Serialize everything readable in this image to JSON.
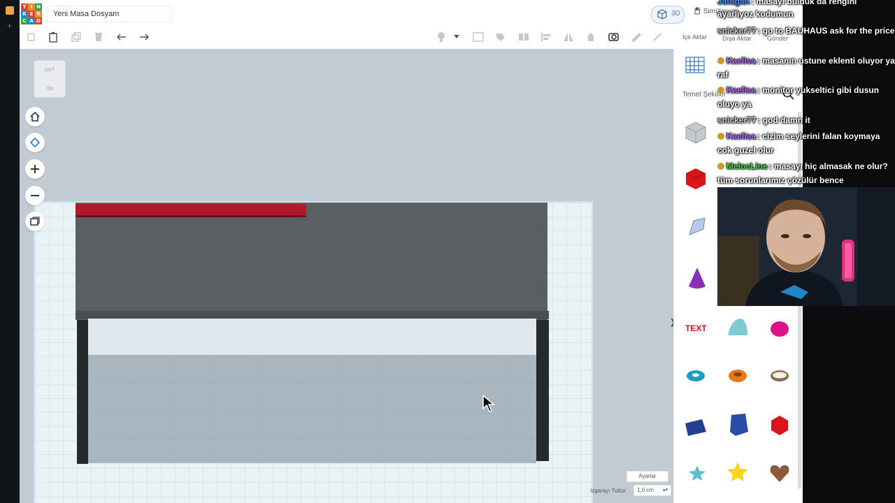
{
  "app": {
    "project_name": "Yeni Masa Dosyam",
    "logo_letters": [
      "T",
      "I",
      "N",
      "K",
      "E",
      "R",
      "C",
      "A",
      "D"
    ],
    "view_3d_label": "3D",
    "simulate_label": "Simülasyon"
  },
  "right_header": {
    "import_label": "İçe Aktar",
    "export_label": "Dışa Aktar",
    "send_label": "Gönder"
  },
  "shapes_panel": {
    "category_label": "Temel Şekiller",
    "shapes": [
      "box-striped",
      "box",
      "scribble",
      "cone",
      "text",
      "roof",
      "paraboloid",
      "torus",
      "tube",
      "ring",
      "wedge",
      "polygon",
      "icosahedron",
      "star-outline",
      "star",
      "heart"
    ]
  },
  "viewcube": {
    "top_label": "ÜST",
    "front_label": "ÖN"
  },
  "workplane": {
    "settings_label": "Ayarlar",
    "snap_label": "Izgarayı Tuttur",
    "snap_value": "1,0 cm"
  },
  "colors": {
    "accent": "#b3182a",
    "desk": "#5b5f62",
    "plate": "#e9f3f6"
  },
  "chat": [
    {
      "user": "Jatugan",
      "user_color": "#3c8cff",
      "badge": false,
      "text": ": masayı bulduk da rengini"
    },
    {
      "user": "",
      "user_color": "#ffffff",
      "badge": false,
      "text": "ayarlıyoz kodumun"
    },
    {
      "user": "snicker77",
      "user_color": "#c9c9c9",
      "badge": false,
      "text": ": go to BAUHAUS ask for the price"
    },
    {
      "user": "Kaelisa",
      "user_color": "#b36bff",
      "badge": true,
      "text": ": masanın ustune eklenti oluyor ya raf"
    },
    {
      "user": "Kaelisa",
      "user_color": "#b36bff",
      "badge": true,
      "text": ": monitor yukseltici gibi dusun oluyo ya"
    },
    {
      "user": "snicker77",
      "user_color": "#c9c9c9",
      "badge": false,
      "text": ": god damn it"
    },
    {
      "user": "Kaelisa",
      "user_color": "#b36bff",
      "badge": true,
      "text": ": cizim seylerini falan koymaya cok guzel olur"
    },
    {
      "user": "MelocLine",
      "user_color": "#3cd63c",
      "badge": true,
      "text": ": masayı hiç almasak ne olur? tüm sorunlarımız çözülür bence"
    }
  ]
}
